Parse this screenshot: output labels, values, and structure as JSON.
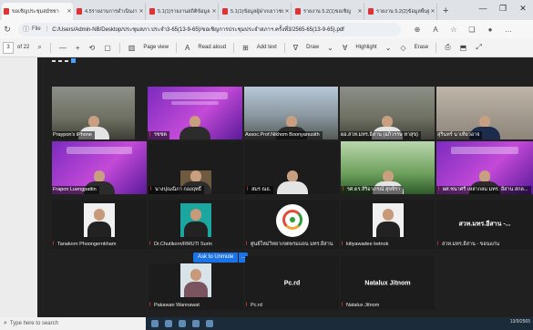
{
  "browser": {
    "tabs": [
      {
        "title": "ขอเชิญประชุมสมัชชา",
        "active": true
      },
      {
        "title": "4.5รายงานการดำเนินงาน",
        "active": false
      },
      {
        "title": "5.1(1)รายงานสถิติข้อมูล",
        "active": false
      },
      {
        "title": "5.1(1)ข้อมูลผู้ฝากเยาวชน",
        "active": false
      },
      {
        "title": "รายงาน 5.2(1)ขอเชิญ",
        "active": false
      },
      {
        "title": "รายงาน 5.2(2)ข้อมูลพื้นฐาน",
        "active": false
      }
    ],
    "new_tab": "+",
    "window_controls": [
      "—",
      "❐",
      "✕"
    ]
  },
  "address": {
    "info_icon": "ⓘ",
    "file_label": "File",
    "path": "C:/Users/Admin-NB/Desktop/ประชุมสภา.ประจำ3-65(13-9-65)/ขอเชิญการประชุมประจำสภาฯ.ครั้งที่3/2565-65(13-9-65).pdf"
  },
  "pdf_toolbar": {
    "page_current": "3",
    "page_total": "of 22",
    "page_view": "Page view",
    "read_aloud": "Read aloud",
    "add_text": "Add text",
    "draw": "Draw",
    "highlight": "Highlight",
    "erase": "Erase"
  },
  "meeting": {
    "participants_row1": [
      "Praypon's iPhone",
      "รชชต",
      "Assoc.Prof.Nikhom Boonyanusith",
      "ผอ.สวท.มทร.อีสาน (อภิวรรษ หาสุข)",
      "สุรินทร์ นาเทียวอาจ"
    ],
    "participants_row2": [
      "Frapon Luengpattin",
      "นางปุณณิภา กองฤทธิ์",
      "สมร ณธ.",
      "รศ.ดร.สิริอาภรณ์ สุขจิรา",
      "ผศ.ชนาศรี เหล่ากลม มทร. อีสาน สกล..."
    ],
    "participants_row3": [
      "Tanakorn Phoongernkham",
      "Dr.Chutikorn/RMUTI Surin",
      "ศูนย์ใหม่วิทยาเขตพรมแดน มทร.อีสาน",
      "kitiyawadee ketnok",
      "สวท.มทร.อีสาน - ขอนแก่น"
    ],
    "participants_row3_title": "สวท.มทร.อีสาน -...",
    "participants_row4": [
      "Pakawan Wannawat",
      "Pc.rd",
      "Natalux Jitnom"
    ],
    "ask_to_unmute": "Ask to Unmute",
    "ask_more": "..."
  },
  "taskbar": {
    "search_placeholder": "Type here to search",
    "clock": "13/9/2565"
  }
}
